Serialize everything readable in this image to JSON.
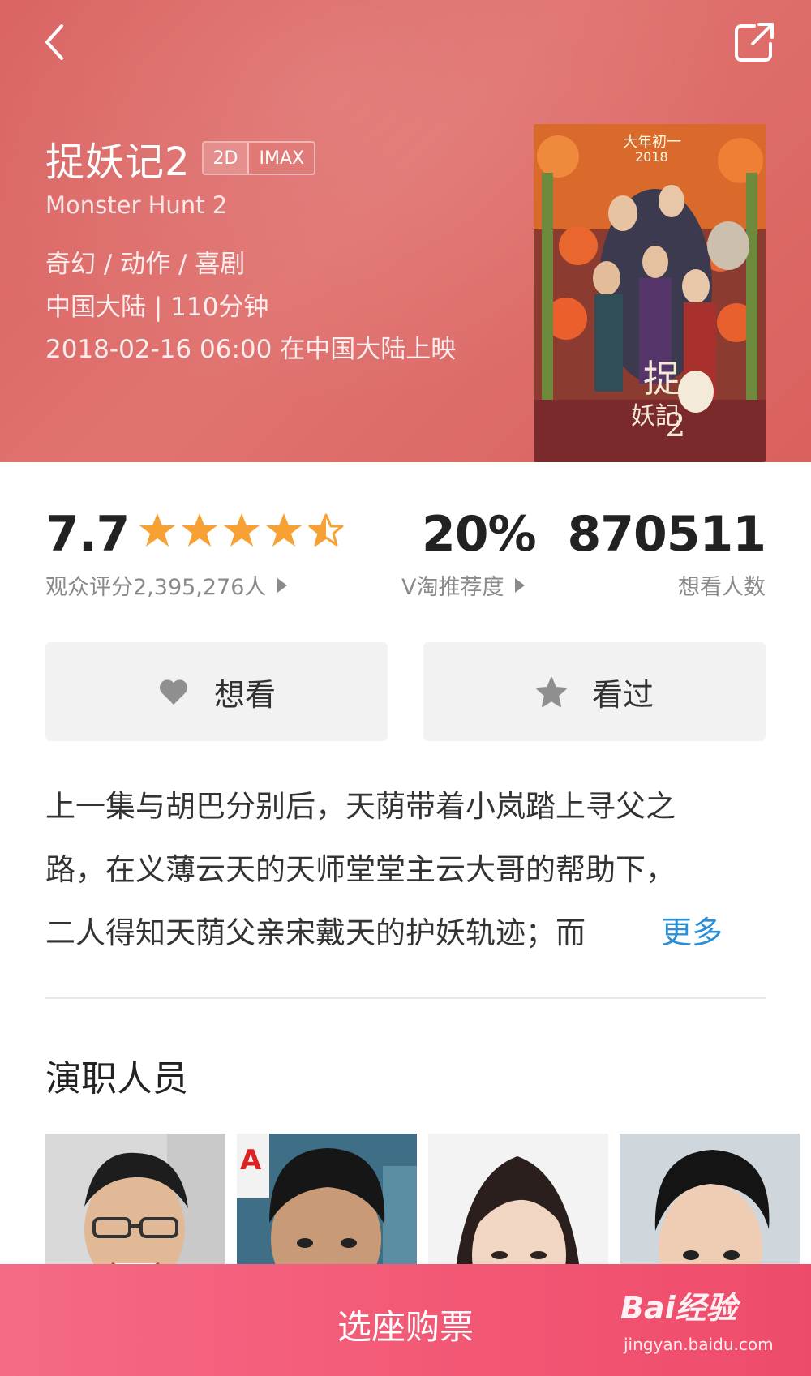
{
  "header": {
    "title": "捉妖记2",
    "formats": [
      "2D",
      "IMAX"
    ],
    "english_title": "Monster Hunt 2",
    "genre": "奇幻 / 动作 / 喜剧",
    "region_duration": "中国大陆 | 110分钟",
    "release": "2018-02-16 06:00 在中国大陆上映",
    "back_icon": "chevron-left-icon",
    "share_icon": "share-icon"
  },
  "stats": {
    "score": "7.7",
    "stars_value": 4.5,
    "stars_max": 5,
    "score_label": "观众评分2,395,276人",
    "recommend_value": "20%",
    "recommend_label": "V淘推荐度",
    "want_count": "870511",
    "want_label": "想看人数"
  },
  "actions": {
    "want_label": "想看",
    "want_icon": "heart-icon",
    "seen_label": "看过",
    "seen_icon": "star-icon"
  },
  "synopsis": {
    "lines": [
      "上一集与胡巴分别后，天荫带着小岚踏上寻父之",
      "路，在义薄云天的天师堂堂主云大哥的帮助下，",
      "二人得知天荫父亲宋戴天的护妖轨迹；而"
    ],
    "more_label": "更多"
  },
  "cast": {
    "title": "演职人员"
  },
  "buy": {
    "label": "选座购票"
  },
  "watermark": {
    "main": "Bai经验",
    "sub": "jingyan.baidu.com"
  },
  "colors": {
    "hero": "#dd6a67",
    "star": "#f7a134",
    "link": "#2a8fd6",
    "buy_bar": "#f35a76"
  }
}
